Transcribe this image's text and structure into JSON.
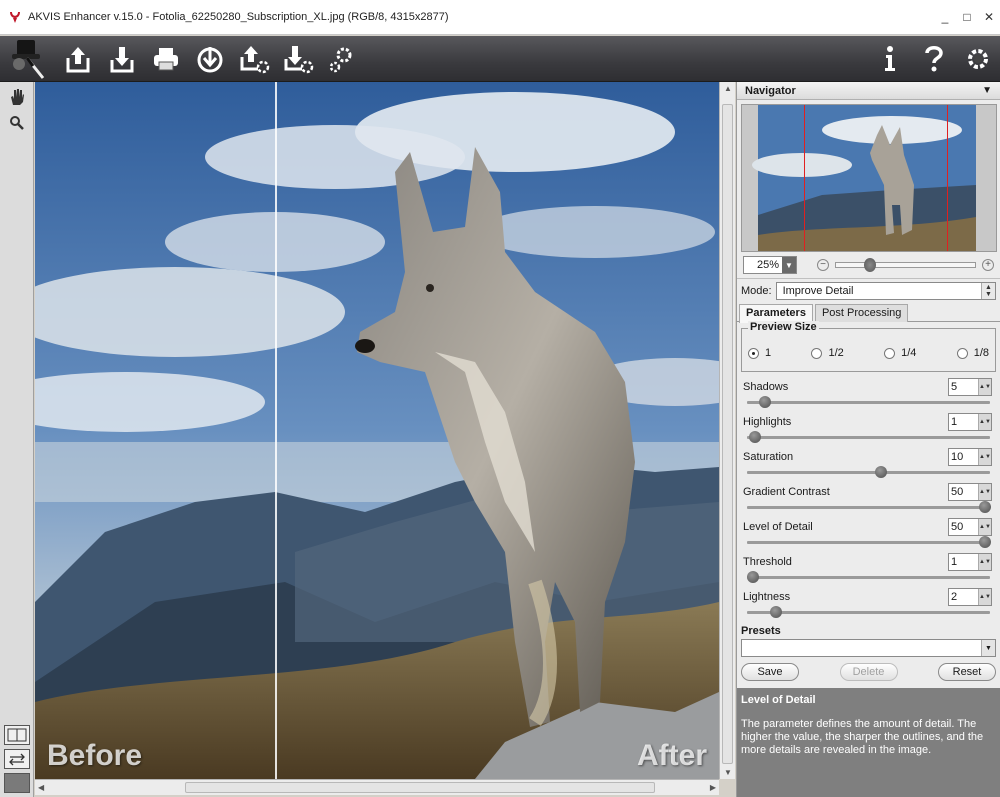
{
  "window": {
    "title": "AKVIS Enhancer v.15.0 - Fotolia_62250280_Subscription_XL.jpg (RGB/8, 4315x2877)",
    "controls": [
      "_",
      "□",
      "✕"
    ]
  },
  "toolbar": {
    "buttons": [
      "logo-icon",
      "open-icon",
      "save-icon",
      "print-icon",
      "share-icon",
      "batch-open-icon",
      "batch-save-icon",
      "batch-settings-icon"
    ],
    "right_buttons": [
      "info-icon",
      "help-icon",
      "settings-icon"
    ]
  },
  "canvas": {
    "label_before": "Before",
    "label_after": "After"
  },
  "navigator": {
    "title": "Navigator",
    "zoom": "25%"
  },
  "mode": {
    "label": "Mode:",
    "value": "Improve Detail"
  },
  "tabs": [
    "Parameters",
    "Post Processing"
  ],
  "preview_size": {
    "title": "Preview Size",
    "options": [
      "1",
      "1/2",
      "1/4",
      "1/8"
    ],
    "selected": 0
  },
  "params": [
    {
      "name": "Shadows",
      "value": "5",
      "min": 0,
      "max": 100
    },
    {
      "name": "Highlights",
      "value": "1",
      "min": 0,
      "max": 100
    },
    {
      "name": "Saturation",
      "value": "10",
      "min": -100,
      "max": 100
    },
    {
      "name": "Gradient Contrast",
      "value": "50",
      "min": 0,
      "max": 50
    },
    {
      "name": "Level of Detail",
      "value": "50",
      "min": 0,
      "max": 50
    },
    {
      "name": "Threshold",
      "value": "1",
      "min": 1,
      "max": 100
    },
    {
      "name": "Lightness",
      "value": "2",
      "min": 0,
      "max": 20
    }
  ],
  "presets": {
    "title": "Presets",
    "save": "Save",
    "delete": "Delete",
    "reset": "Reset"
  },
  "help": {
    "title": "Level of Detail",
    "text": "The parameter defines the amount of detail. The higher the value, the sharper the outlines, and the more details are revealed in the image."
  }
}
